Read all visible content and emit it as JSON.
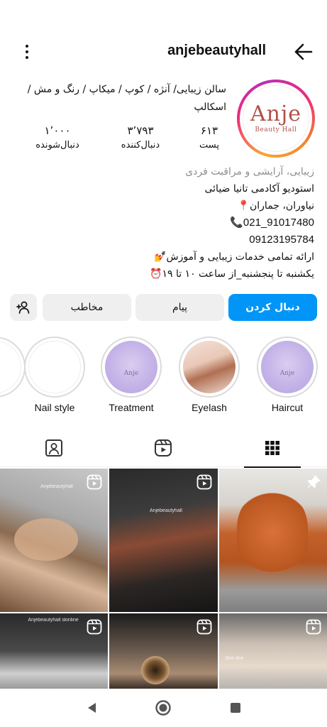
{
  "header": {
    "username": "anjebeautyhall"
  },
  "profile": {
    "avatar_logo_main": "Anje",
    "avatar_logo_sub": "Beauty Hall",
    "category_line": "سالن زیبایی/ آنژه / کوپ / میکاپ / رنگ و مش / اسکالپ",
    "stats": {
      "posts_count": "۶۱۳",
      "posts_label": "پست",
      "followers_count": "۳٬۷۹۳",
      "followers_label": "دنبال‌کننده",
      "following_count": "۱٬۰۰۰",
      "following_label": "دنبال‌شونده"
    },
    "bio": {
      "category": "زیبایی، آرایشی و مراقبت فردی",
      "line1": "استودیو آکادمی تانیا ضیائی",
      "line2": "نیاوران، جماران📍",
      "phone1": "📞021_91017480",
      "phone2": "09123195784",
      "line3": "ارائه تمامی خدمات زیبایی و آموزش💅",
      "line4": "یکشنبه تا پنجشنبه_از ساعت ۱۰ تا ۱۹⏰"
    }
  },
  "actions": {
    "follow_label": "دنبال کردن",
    "message_label": "پیام",
    "contact_label": "مخاطب"
  },
  "highlights": [
    {
      "label": "Haircut"
    },
    {
      "label": "Eyelash"
    },
    {
      "label": "Treatment"
    },
    {
      "label": "Nail style"
    }
  ],
  "highlight_logo_text": "Anje",
  "posts": [
    {
      "overlay": "Anjebeautyhall"
    },
    {
      "overlay": "Anjebeautyhall"
    },
    {
      "overlay": ""
    },
    {
      "overlay": "Anjebeautyhall skinline"
    },
    {
      "overlay": ""
    },
    {
      "overlay": "Skin line"
    }
  ],
  "colors": {
    "accent": "#0095f6",
    "avatar_ring_start": "#f9a43a",
    "avatar_ring_end": "#b72fb8",
    "logo": "#b0524a"
  },
  "icons": {
    "menu": "kebab-vertical-icon",
    "back": "arrow-right-icon",
    "add_user": "add-person-icon",
    "tab_grid": "grid-icon",
    "tab_reels": "reels-icon",
    "tab_tagged": "tagged-person-icon",
    "post_reel": "reel-badge-icon",
    "post_pin": "pin-icon"
  }
}
